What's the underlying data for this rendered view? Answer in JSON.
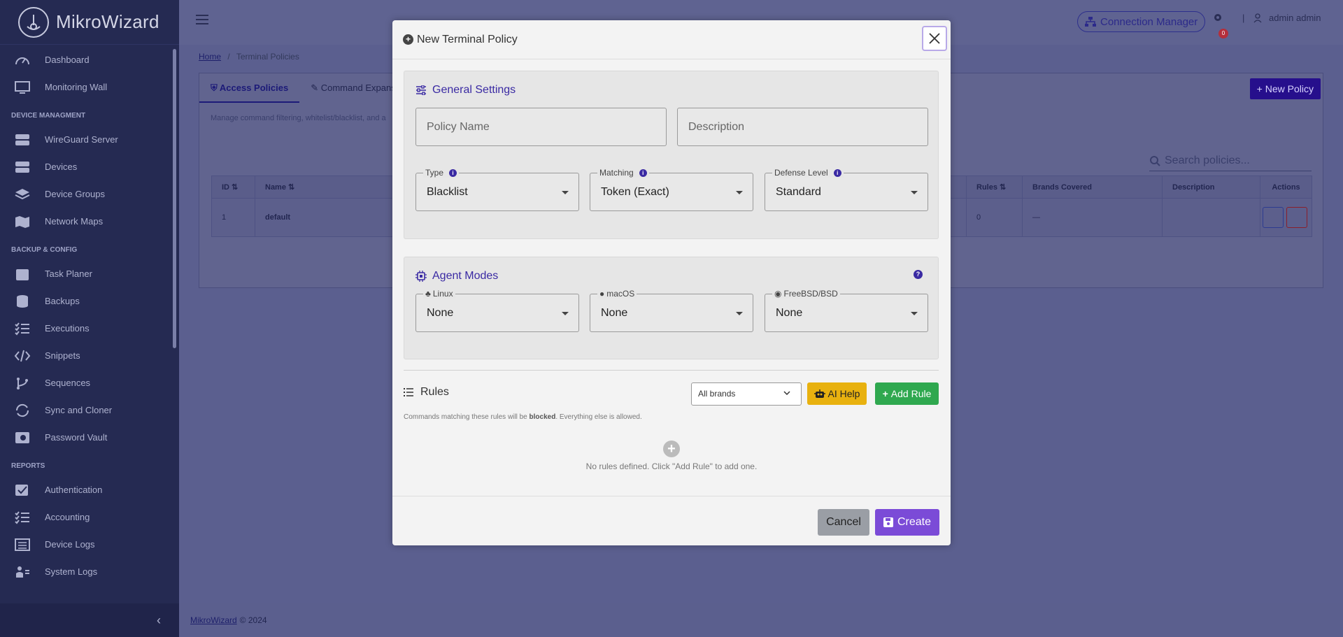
{
  "app": {
    "name": "MikroWizard"
  },
  "sidebar": {
    "items": [
      {
        "label": "Dashboard",
        "icon": "dashboard-icon"
      },
      {
        "label": "Monitoring Wall",
        "icon": "monitor-icon"
      }
    ],
    "sections": [
      {
        "title": "DEVICE MANAGMENT",
        "items": [
          {
            "label": "WireGuard Server",
            "icon": "server-icon"
          },
          {
            "label": "Devices",
            "icon": "devices-icon"
          },
          {
            "label": "Device Groups",
            "icon": "layers-icon"
          },
          {
            "label": "Network Maps",
            "icon": "map-icon"
          }
        ]
      },
      {
        "title": "BACKUP & CONFIG",
        "items": [
          {
            "label": "Task Planer",
            "icon": "calendar-icon"
          },
          {
            "label": "Backups",
            "icon": "database-icon"
          },
          {
            "label": "Executions",
            "icon": "list-check-icon"
          },
          {
            "label": "Snippets",
            "icon": "code-icon"
          },
          {
            "label": "Sequences",
            "icon": "branch-icon"
          },
          {
            "label": "Sync and Cloner",
            "icon": "sync-icon"
          },
          {
            "label": "Password Vault",
            "icon": "vault-icon"
          }
        ]
      },
      {
        "title": "REPORTS",
        "items": [
          {
            "label": "Authentication",
            "icon": "auth-check-icon"
          },
          {
            "label": "Accounting",
            "icon": "list-check-icon"
          },
          {
            "label": "Device Logs",
            "icon": "list-icon"
          },
          {
            "label": "System Logs",
            "icon": "user-logs-icon"
          }
        ]
      }
    ]
  },
  "header": {
    "connection_manager": "Connection Manager",
    "notification_count": "0",
    "user": "admin admin"
  },
  "breadcrumb": {
    "home": "Home",
    "separator": "/",
    "current": "Terminal Policies"
  },
  "page": {
    "tabs": [
      {
        "label": "Access Policies",
        "active": true
      },
      {
        "label": "Command Expansi",
        "active": false
      }
    ],
    "new_policy": "New Policy",
    "description": "Manage command filtering, whitelist/blacklist, and a",
    "search_placeholder": "Search policies...",
    "table": {
      "headers": {
        "id": "ID",
        "name": "Name",
        "rules": "Rules",
        "brands": "Brands Covered",
        "description": "Description",
        "actions": "Actions"
      },
      "rows": [
        {
          "id": "1",
          "name": "default",
          "rules": "0",
          "brands": "—",
          "description": ""
        }
      ]
    }
  },
  "footer": {
    "link": "MikroWizard",
    "copyright": "© 2024"
  },
  "modal": {
    "title": "New Terminal Policy",
    "general": {
      "title": "General Settings",
      "policy_name_placeholder": "Policy Name",
      "description_placeholder": "Description",
      "type_label": "Type",
      "type_value": "Blacklist",
      "matching_label": "Matching",
      "matching_value": "Token (Exact)",
      "defense_label": "Defense Level",
      "defense_value": "Standard"
    },
    "agent": {
      "title": "Agent Modes",
      "linux_label": "Linux",
      "linux_value": "None",
      "macos_label": "macOS",
      "macos_value": "None",
      "bsd_label": "FreeBSD/BSD",
      "bsd_value": "None"
    },
    "rules": {
      "title": "Rules",
      "brand_filter": "All brands",
      "ai_help": "AI Help",
      "add_rule": "Add Rule",
      "note_before": "Commands matching these rules will be ",
      "note_bold": "blocked",
      "note_after": ". Everything else is allowed.",
      "empty": "No rules defined. Click \"Add Rule\" to add one."
    },
    "cancel": "Cancel",
    "create": "Create"
  },
  "colors": {
    "accent": "#3a2aa3",
    "create": "#7b4bd7",
    "ai_help": "#e8b10f",
    "add_rule": "#2fa84f",
    "sidebar": "#252a52"
  }
}
